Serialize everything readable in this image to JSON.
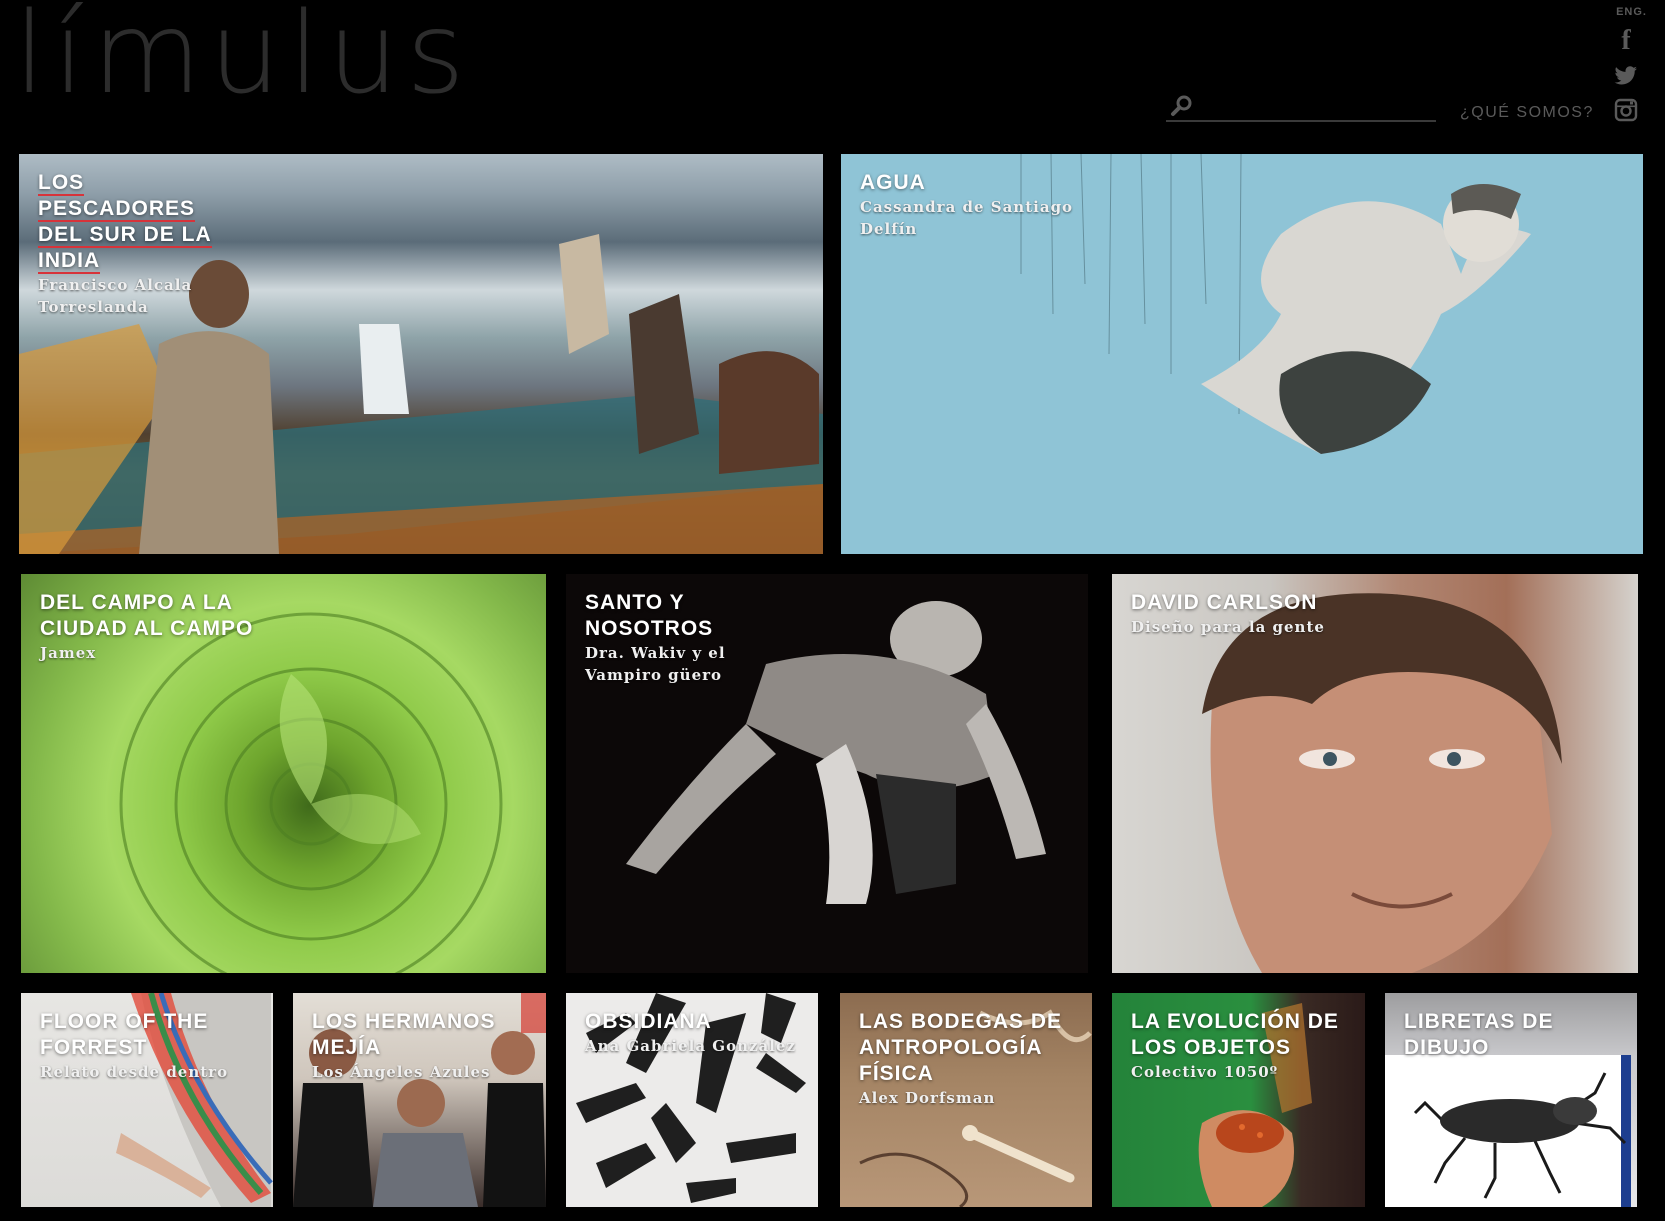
{
  "brand": {
    "logo_text": "límulus"
  },
  "header": {
    "lang_label": "ENG.",
    "about_label": "¿QUÉ SOMOS?",
    "search_value": "",
    "search_placeholder": ""
  },
  "social": {
    "facebook_icon": "facebook-icon",
    "twitter_icon": "twitter-icon",
    "instagram_icon": "instagram-icon"
  },
  "tiles": [
    {
      "title": "LOS PESCADORES DEL SUR DE LA INDIA",
      "author": "Francisco Alcala Torreslanda",
      "image": "fishermen-beach-photo"
    },
    {
      "title": "AGUA",
      "author": "Cassandra de Santiago Delfín",
      "image": "boy-hanging-threads-art"
    },
    {
      "title": "DEL CAMPO A LA CIUDAD AL CAMPO",
      "author": "Jamex",
      "image": "green-succulent-photo"
    },
    {
      "title": "SANTO Y NOSOTROS",
      "author": "Dra. Wakiv y el Vampiro güero",
      "image": "wrestler-bw-photo"
    },
    {
      "title": "DAVID CARLSON",
      "author": "Diseño para la gente",
      "image": "man-portrait-photo"
    },
    {
      "title": "FLOOR OF THE FORREST",
      "author": "Relato desde dentro",
      "image": "hammock-feet-photo"
    },
    {
      "title": "LOS HERMANOS MEJÍA",
      "author": "Los Ángeles Azules",
      "image": "group-people-photo"
    },
    {
      "title": "OBSIDIANA",
      "author": "Ana Gabriela González",
      "image": "obsidian-blades-photo"
    },
    {
      "title": "LAS BODEGAS DE ANTROPOLOGÍA FÍSICA",
      "author": "Alex Dorfsman",
      "image": "bones-sand-photo"
    },
    {
      "title": "LA EVOLUCIÓN DE LOS OBJETOS",
      "author": "Colectivo 1050º",
      "image": "hand-red-powder-photo"
    },
    {
      "title": "LIBRETAS DE DIBUJO",
      "author": "",
      "image": "beetle-drawing-photo"
    }
  ],
  "colors": {
    "background": "#000000",
    "header_text": "#5a5a5a",
    "logo": "#2c2c2c",
    "title_underline": "#d7333a",
    "tile_text": "#ffffff"
  }
}
